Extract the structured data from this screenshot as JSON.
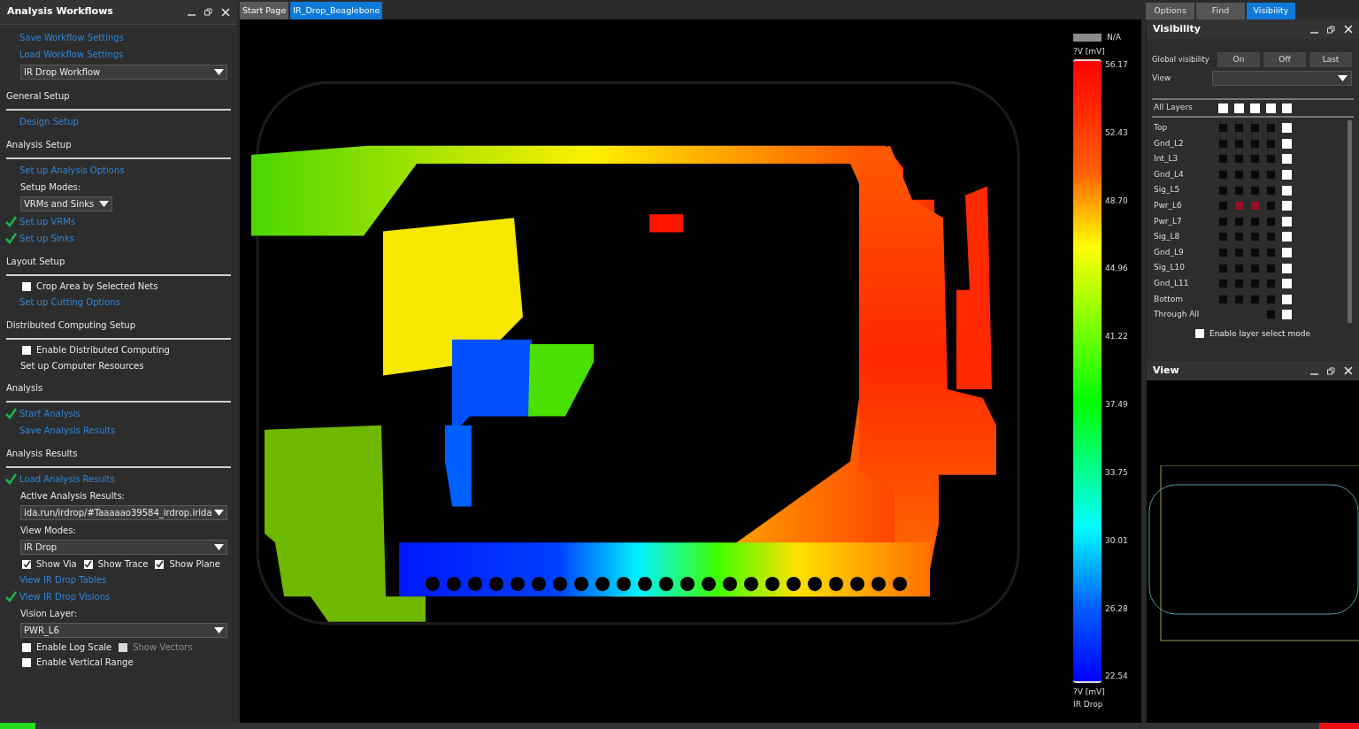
{
  "left_panel": {
    "title": "Analysis Workflows",
    "items": [
      {
        "kind": "link",
        "label": "Save Workflow Settings",
        "done": false
      },
      {
        "kind": "link",
        "label": "Load Workflow Settings",
        "done": false
      },
      {
        "kind": "dropdown",
        "value": "IR Drop Workflow",
        "wide": true
      },
      {
        "kind": "section",
        "label": "General Setup"
      },
      {
        "kind": "link",
        "label": "Design Setup",
        "done": false
      },
      {
        "kind": "section",
        "label": "Analysis Setup"
      },
      {
        "kind": "link",
        "label": "Set up Analysis Options",
        "done": false
      },
      {
        "kind": "label",
        "label": "Setup Modes:"
      },
      {
        "kind": "dropdown",
        "value": "VRMs and Sinks",
        "wide": false
      },
      {
        "kind": "link",
        "label": "Set up VRMs",
        "done": true
      },
      {
        "kind": "link",
        "label": "Set up Sinks",
        "done": true
      },
      {
        "kind": "section",
        "label": "Layout Setup"
      },
      {
        "kind": "checks",
        "boxes": [
          {
            "label": "Crop Area by Selected Nets",
            "checked": false,
            "disabled": false
          }
        ]
      },
      {
        "kind": "link",
        "label": "Set up Cutting Options",
        "done": false
      },
      {
        "kind": "section",
        "label": "Distributed Computing Setup"
      },
      {
        "kind": "checks",
        "boxes": [
          {
            "label": "Enable Distributed Computing",
            "checked": false,
            "disabled": false
          }
        ]
      },
      {
        "kind": "label",
        "label": "Set up Computer Resources"
      },
      {
        "kind": "section",
        "label": "Analysis"
      },
      {
        "kind": "link",
        "label": "Start Analysis",
        "done": true
      },
      {
        "kind": "link",
        "label": "Save Analysis Results",
        "done": false
      },
      {
        "kind": "section",
        "label": "Analysis Results"
      },
      {
        "kind": "link",
        "label": "Load Analysis Results",
        "done": true
      },
      {
        "kind": "label",
        "label": "Active Analysis Results:"
      },
      {
        "kind": "dropdown",
        "value": "ida.run/irdrop/#Taaaaao39584_irdrop.irida",
        "wide": true
      },
      {
        "kind": "label",
        "label": "View Modes:"
      },
      {
        "kind": "dropdown",
        "value": "IR Drop",
        "wide": true
      },
      {
        "kind": "checks",
        "boxes": [
          {
            "label": "Show Via",
            "checked": true,
            "disabled": false
          },
          {
            "label": "Show Trace",
            "checked": true,
            "disabled": false
          },
          {
            "label": "Show Plane",
            "checked": true,
            "disabled": false
          }
        ]
      },
      {
        "kind": "link",
        "label": "View IR Drop Tables",
        "done": false
      },
      {
        "kind": "link",
        "label": "View IR Drop Visions",
        "done": true
      },
      {
        "kind": "label",
        "label": "Vision Layer:"
      },
      {
        "kind": "dropdown",
        "value": "PWR_L6",
        "wide": true
      },
      {
        "kind": "checks",
        "boxes": [
          {
            "label": "Enable Log Scale",
            "checked": false,
            "disabled": false
          },
          {
            "label": "Show Vectors",
            "checked": false,
            "disabled": true
          }
        ]
      },
      {
        "kind": "checks",
        "boxes": [
          {
            "label": "Enable Vertical Range",
            "checked": false,
            "disabled": false
          }
        ]
      }
    ]
  },
  "doc_tabs": [
    {
      "label": "Start Page",
      "selected": false
    },
    {
      "label": "IR_Drop_Beaglebone",
      "selected": true
    }
  ],
  "legend": {
    "na_label": "N/A",
    "unit_top": "?V [mV]",
    "ticks": [
      "56.17",
      "52.43",
      "48.70",
      "44.96",
      "41.22",
      "37.49",
      "33.75",
      "30.01",
      "26.28",
      "22.54"
    ],
    "unit_bottom": "?V [mV]",
    "mode": "IR Drop"
  },
  "right_tabs": [
    {
      "label": "Options",
      "selected": false
    },
    {
      "label": "Find",
      "selected": false
    },
    {
      "label": "Visibility",
      "selected": true
    }
  ],
  "visibility": {
    "title": "Visibility",
    "global_label": "Global visibility",
    "buttons": [
      "On",
      "Off",
      "Last"
    ],
    "view_label": "View",
    "all_layers": "All Layers",
    "layers": [
      {
        "name": "Top",
        "cells": [
          false,
          false,
          false,
          false
        ]
      },
      {
        "name": "Gnd_L2",
        "cells": [
          false,
          false,
          false,
          false
        ]
      },
      {
        "name": "Int_L3",
        "cells": [
          false,
          false,
          false,
          false
        ]
      },
      {
        "name": "Gnd_L4",
        "cells": [
          false,
          false,
          false,
          false
        ]
      },
      {
        "name": "Sig_L5",
        "cells": [
          false,
          false,
          false,
          false
        ]
      },
      {
        "name": "Pwr_L6",
        "cells": [
          false,
          true,
          true,
          false
        ]
      },
      {
        "name": "Pwr_L7",
        "cells": [
          false,
          false,
          false,
          false
        ]
      },
      {
        "name": "Sig_L8",
        "cells": [
          false,
          false,
          false,
          false
        ]
      },
      {
        "name": "Gnd_L9",
        "cells": [
          false,
          false,
          false,
          false
        ]
      },
      {
        "name": "Sig_L10",
        "cells": [
          false,
          false,
          false,
          false
        ]
      },
      {
        "name": "Gnd_L11",
        "cells": [
          false,
          false,
          false,
          false
        ]
      },
      {
        "name": "Bottom",
        "cells": [
          false,
          false,
          false,
          false
        ]
      },
      {
        "name": "Through All",
        "cells": [
          null,
          null,
          null,
          false
        ]
      }
    ],
    "select_mode": {
      "label": "Enable layer select mode",
      "checked": false
    }
  },
  "view_panel": {
    "title": "View"
  }
}
